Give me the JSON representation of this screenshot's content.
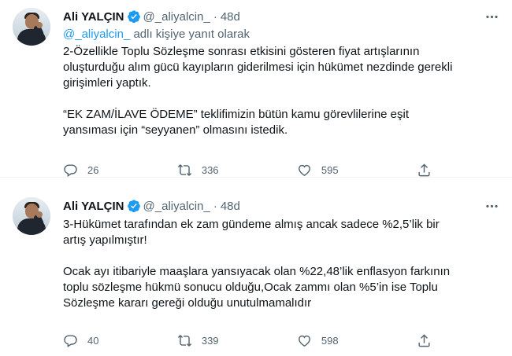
{
  "tweets": [
    {
      "author": "Ali YALÇIN",
      "handle": "@_aliyalcin_",
      "dot": "·",
      "time": "48d",
      "reply_to": "@_aliyalcin_",
      "reply_suffix": "adlı kişiye yanıt olarak",
      "paragraphs": [
        "2-Özellikle Toplu Sözleşme sonrası etkisini gösteren fiyat artışlarının\noluşturduğu alım gücü kayıpların giderilmesi için hükümet nezdinde gerekli\ngirişimleri yaptık.",
        "“EK ZAM/İLAVE ÖDEME” teklifimizin bütün kamu görevlilerine eşit\nyansıması için “seyyanen” olmasını istedik."
      ],
      "replies": "26",
      "retweets": "336",
      "likes": "595"
    },
    {
      "author": "Ali YALÇIN",
      "handle": "@_aliyalcin_",
      "dot": "·",
      "time": "48d",
      "paragraphs": [
        "3-Hükümet tarafından ek zam gündeme almış ancak  sadece %2,5’lik bir\nartış yapılmıştır!",
        "Ocak ayı itibariyle maaşlara yansıyacak olan %22,48’lik enflasyon farkının\ntoplu sözleşme hükmü sonucu olduğu,Ocak zammı olan %5’in ise Toplu\nSözleşme kararı gereği olduğu unutulmamalıdır"
      ],
      "replies": "40",
      "retweets": "339",
      "likes": "598"
    }
  ],
  "colors": {
    "verified": "#1d9bf0",
    "link": "#1d9bf0",
    "secondary": "#536471"
  },
  "icons": [
    "verified-badge-icon",
    "more-icon",
    "reply-icon",
    "retweet-icon",
    "like-icon",
    "share-icon"
  ]
}
